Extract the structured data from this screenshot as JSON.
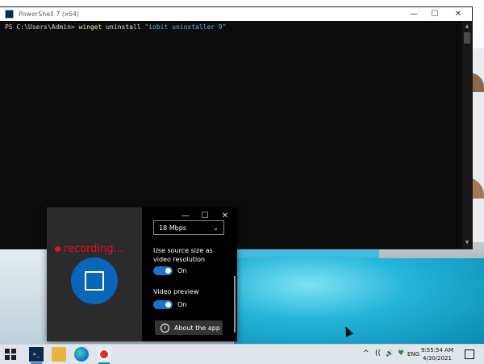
{
  "powershell": {
    "title": "PowerShell 7 (x64)",
    "prompt": "PS C:\\Users\\Admin> ",
    "command": "winget",
    "args": " uninstall ",
    "string_arg": "\"iobit uninstaller 9\"",
    "controls": {
      "minimize": "—",
      "maximize": "☐",
      "close": "✕"
    }
  },
  "recorder": {
    "status_text": "recording...",
    "bitrate": {
      "value": "18 Mbps",
      "chevron": "⌄"
    },
    "source_size": {
      "label": "Use source size as video resolution",
      "state": "On"
    },
    "video_preview": {
      "label": "Video preview",
      "state": "On"
    },
    "about_label": "About the app",
    "controls": {
      "minimize": "—",
      "maximize": "☐",
      "close": "✕"
    },
    "colors": {
      "recording": "#e81123",
      "stop_button": "#0a66b8",
      "toggle_on": "#1a73c8"
    }
  },
  "taskbar": {
    "apps": [
      {
        "name": "PowerShell",
        "icon": "powershell-icon",
        "glyph": ">_"
      },
      {
        "name": "File Explorer",
        "icon": "folder-icon"
      },
      {
        "name": "Microsoft Edge",
        "icon": "edge-icon"
      },
      {
        "name": "Recorder",
        "icon": "recorder-icon"
      }
    ],
    "tray": {
      "chevron": "^",
      "network": "((",
      "volume": "🔊",
      "security": "♥",
      "language": "ENG"
    },
    "clock": {
      "time": "9:55:54 AM",
      "date": "4/30/2021"
    }
  }
}
